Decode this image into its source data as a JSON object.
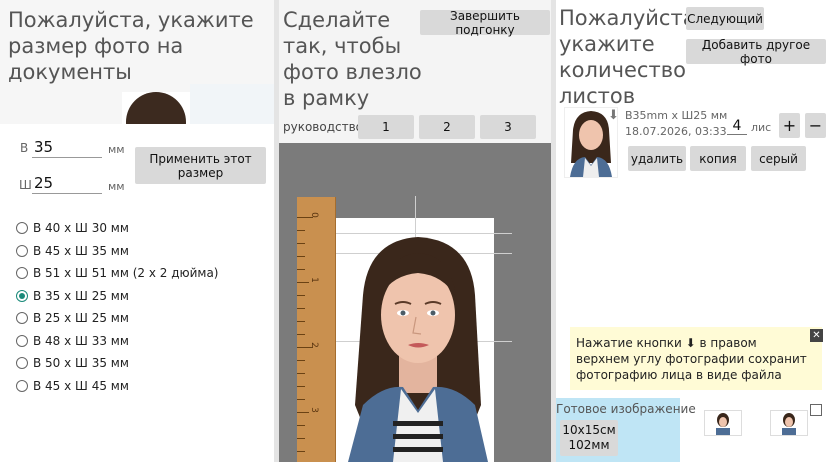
{
  "panel1": {
    "title": "Пожалуйста, укажите размер фото на документы",
    "height_label": "В",
    "height_value": "35",
    "width_label": "Ш",
    "width_value": "25",
    "unit": "мм",
    "apply_button": "Применить этот размер",
    "presets": [
      {
        "label": "В 40 x Ш 30 мм",
        "selected": false
      },
      {
        "label": "В 45 x Ш 35 мм",
        "selected": false
      },
      {
        "label": "В 51 x Ш 51 мм (2 x 2 дюйма)",
        "selected": false
      },
      {
        "label": "В 35 x Ш 25 мм",
        "selected": true
      },
      {
        "label": "В 25 x Ш 25 мм",
        "selected": false
      },
      {
        "label": "В 48 x Ш 33 мм",
        "selected": false
      },
      {
        "label": "В 50 x Ш 35 мм",
        "selected": false
      },
      {
        "label": "В 45 x Ш 45 мм",
        "selected": false
      }
    ]
  },
  "panel2": {
    "title": "Сделайте так, чтобы фото влезло в рамку",
    "finish_button": "Завершить подгонку",
    "guide_label": "руководство",
    "guide_buttons": [
      "1",
      "2",
      "3"
    ],
    "ruler_numbers": [
      "0",
      "1",
      "2",
      "3"
    ]
  },
  "panel3": {
    "title": "Пожалуйста, укажите количество листов",
    "next_button": "Следующий",
    "add_photo_button": "Добавить другое фото",
    "item": {
      "size": "В35mm x Ш25 мм",
      "date": "18.07.2026, 03:33",
      "quantity": "4",
      "sheets_unit": "лис",
      "plus": "+",
      "minus": "−",
      "delete_button": "удалить",
      "copy_button": "копия",
      "gray_button": "серый"
    },
    "tooltip": "Нажатие кнопки ⬇ в правом верхнем углу фотографии сохранит фотографию лица в виде файла",
    "close_symbol": "✕",
    "ready_label": "Готовое изображение",
    "paper_size": "10x15см 102мм"
  },
  "colors": {
    "accent_radio": "#1a8a7a",
    "button_bg": "#d9d9d9",
    "tooltip_bg": "#fffbd6",
    "ready_bg": "#bfe5f5",
    "ruler": "#c9904f"
  }
}
